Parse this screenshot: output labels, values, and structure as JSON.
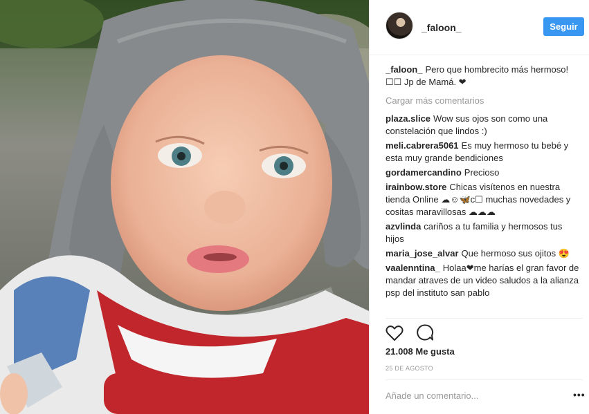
{
  "post": {
    "username": "_faloon_",
    "follow_label": "Seguir",
    "caption": {
      "user": "_faloon_",
      "text": "Pero que hombrecito más hermoso! ☐☐ Jp de Mamá. ❤"
    },
    "load_more": "Cargar más comentarios",
    "comments": [
      {
        "user": "plaza.slice",
        "text": "Wow sus ojos son como una constelación que lindos :)"
      },
      {
        "user": "meli.cabrera5061",
        "text": "Es muy hermoso tu bebé y esta muy grande bendiciones"
      },
      {
        "user": "gordamercandino",
        "text": "Precioso"
      },
      {
        "user": "irainbow.store",
        "text": "Chicas visítenos en nuestra tienda Online ☁☺🦋c☐ muchas novedades y cositas maravillosas ☁☁☁"
      },
      {
        "user": "azvlinda",
        "text": "cariños a tu familia y hermosos tus hijos"
      },
      {
        "user": "maria_jose_alvar",
        "text": "Que hermoso sus ojitos 😍"
      },
      {
        "user": "vaalenntina_",
        "text": "Holaa❤me harías el gran favor de mandar atraves de un video saludos a la alianza psp del instituto san pablo"
      }
    ],
    "likes": "21.008 Me gusta",
    "date": "25 DE AGOSTO",
    "add_comment_placeholder": "Añade un comentario...",
    "more_label": "•••",
    "icons": [
      "heart-icon",
      "comment-icon"
    ],
    "colors": {
      "accent": "#3897f0",
      "muted": "#999999",
      "text": "#262626"
    }
  }
}
